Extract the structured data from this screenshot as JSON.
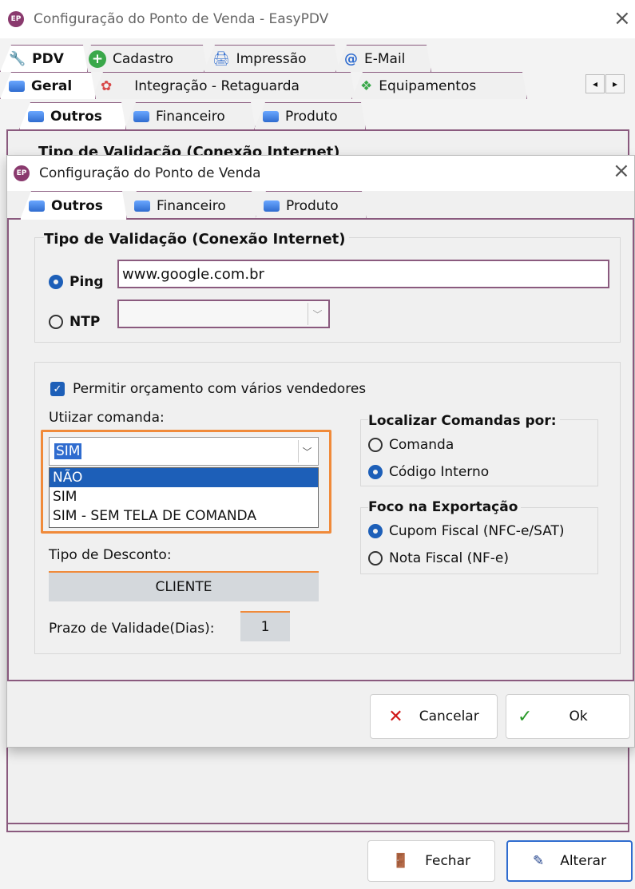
{
  "back_window": {
    "title": "Configuração do Ponto de Venda - EasyPDV",
    "app_icon": "EP",
    "tabs_row1": [
      {
        "label": "PDV",
        "icon": "pdv-icon"
      },
      {
        "label": "Cadastro",
        "icon": "plus-icon"
      },
      {
        "label": "Impressão",
        "icon": "printer-icon"
      },
      {
        "label": "E-Mail",
        "icon": "email-icon"
      }
    ],
    "tabs_row2": [
      {
        "label": "Geral",
        "icon": "grid-icon"
      },
      {
        "label": "Integração - Retaguarda",
        "icon": "sync-icon"
      },
      {
        "label": "Equipamentos",
        "icon": "equipment-icon"
      }
    ],
    "tabs_row3": [
      {
        "label": "Outros"
      },
      {
        "label": "Financeiro"
      },
      {
        "label": "Produto"
      }
    ],
    "partial_heading": "Tipo de Validação (Conexão Internet)",
    "fechar_label": "Fechar",
    "alterar_label": "Alterar"
  },
  "dialog": {
    "title": "Configuração do Ponto de Venda",
    "app_icon": "EP",
    "tabs": [
      {
        "label": "Outros"
      },
      {
        "label": "Financeiro"
      },
      {
        "label": "Produto"
      }
    ],
    "validation": {
      "heading": "Tipo de Validação (Conexão Internet)",
      "ping_label": "Ping",
      "ping_value": "www.google.com.br",
      "ntp_label": "NTP",
      "ntp_value": ""
    },
    "permitir_label": "Permitir orçamento com vários vendedores",
    "comanda": {
      "label": "Utiizar comanda:",
      "selected": "SIM",
      "options": [
        "NÃO",
        "SIM",
        "SIM - SEM TELA DE COMANDA"
      ]
    },
    "localizar": {
      "heading": "Localizar Comandas por:",
      "options": [
        "Comanda",
        "Código Interno"
      ]
    },
    "foco": {
      "heading": "Foco na Exportação",
      "options": [
        "Cupom Fiscal (NFC-e/SAT)",
        "Nota Fiscal (NF-e)"
      ]
    },
    "desconto": {
      "label": "Tipo de Desconto:",
      "value": "CLIENTE"
    },
    "prazo": {
      "label": "Prazo de Validade(Dias):",
      "value": "1"
    },
    "cancel_label": "Cancelar",
    "ok_label": "Ok"
  },
  "colors": {
    "accent": "#1d5fb8",
    "tab_border": "#8a5a7e",
    "dropdown_highlight": "#f08a3a"
  }
}
